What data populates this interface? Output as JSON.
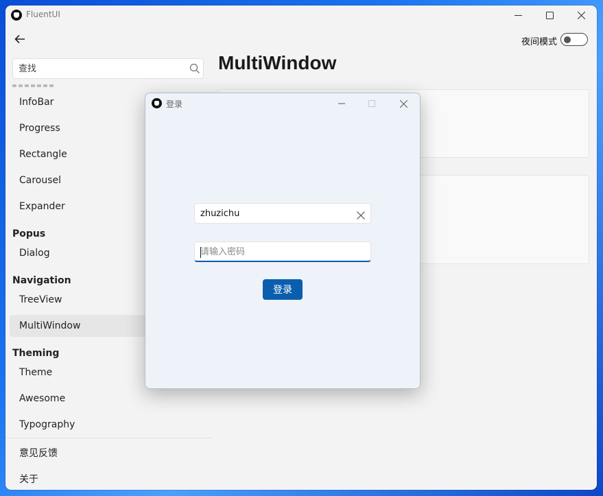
{
  "window": {
    "app_title": "FluentUI",
    "controls": {
      "minimize": "—",
      "maximize": "☐",
      "close": "✕"
    }
  },
  "header": {
    "night_mode_label": "夜间模式",
    "night_mode_on": false
  },
  "search": {
    "placeholder": "查找",
    "value": ""
  },
  "sidebar": {
    "items": [
      {
        "label": "InfoBar"
      },
      {
        "label": "Progress"
      },
      {
        "label": "Rectangle"
      },
      {
        "label": "Carousel"
      },
      {
        "label": "Expander"
      }
    ],
    "groups": [
      {
        "header": "Popus",
        "items": [
          {
            "label": "Dialog"
          }
        ]
      },
      {
        "header": "Navigation",
        "items": [
          {
            "label": "TreeView"
          },
          {
            "label": "MultiWindow",
            "selected": true
          }
        ]
      },
      {
        "header": "Theming",
        "items": [
          {
            "label": "Theme"
          },
          {
            "label": "Awesome"
          },
          {
            "label": "Typography"
          }
        ]
      }
    ],
    "footer": [
      {
        "label": "意见反馈"
      },
      {
        "label": "关于"
      }
    ]
  },
  "main": {
    "title": "MultiWindow"
  },
  "login_dialog": {
    "title": "登录",
    "username": {
      "value": "zhuzichu"
    },
    "password": {
      "placeholder": "请输入密码",
      "value": ""
    },
    "submit_label": "登录"
  },
  "colors": {
    "accent": "#0b5ead",
    "window_bg": "#f3f3f3",
    "dialog_bg": "#eef2f9",
    "selected_item_bg": "#e6e6e6"
  }
}
